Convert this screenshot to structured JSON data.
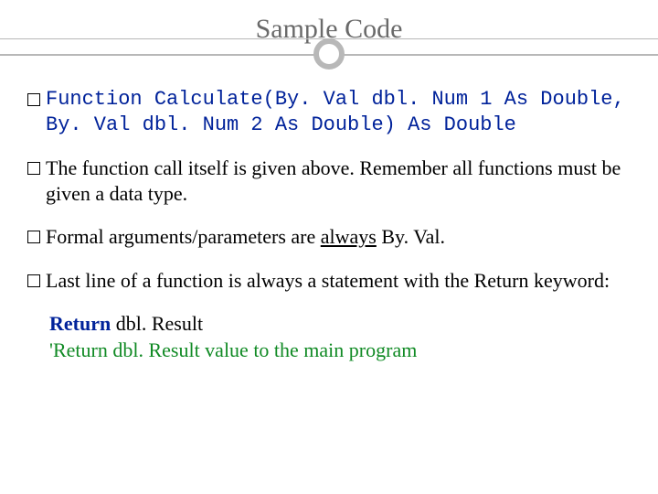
{
  "title": "Sample Code",
  "bullets": [
    {
      "code": "Function Calculate(By. Val dbl. Num 1 As Double, By. Val dbl. Num 2 As Double) As Double"
    },
    {
      "pre": "The function call itself is given above. Remember all functions must be given a data type."
    },
    {
      "pre": "Formal arguments/parameters are ",
      "underline": "always",
      "post": " By. Val."
    },
    {
      "pre": "Last line of a function is always a statement with the Return keyword:"
    }
  ],
  "return_block": {
    "keyword": "Return",
    "value": " dbl. Result",
    "comment": "'Return dbl. Result value to the main program"
  }
}
